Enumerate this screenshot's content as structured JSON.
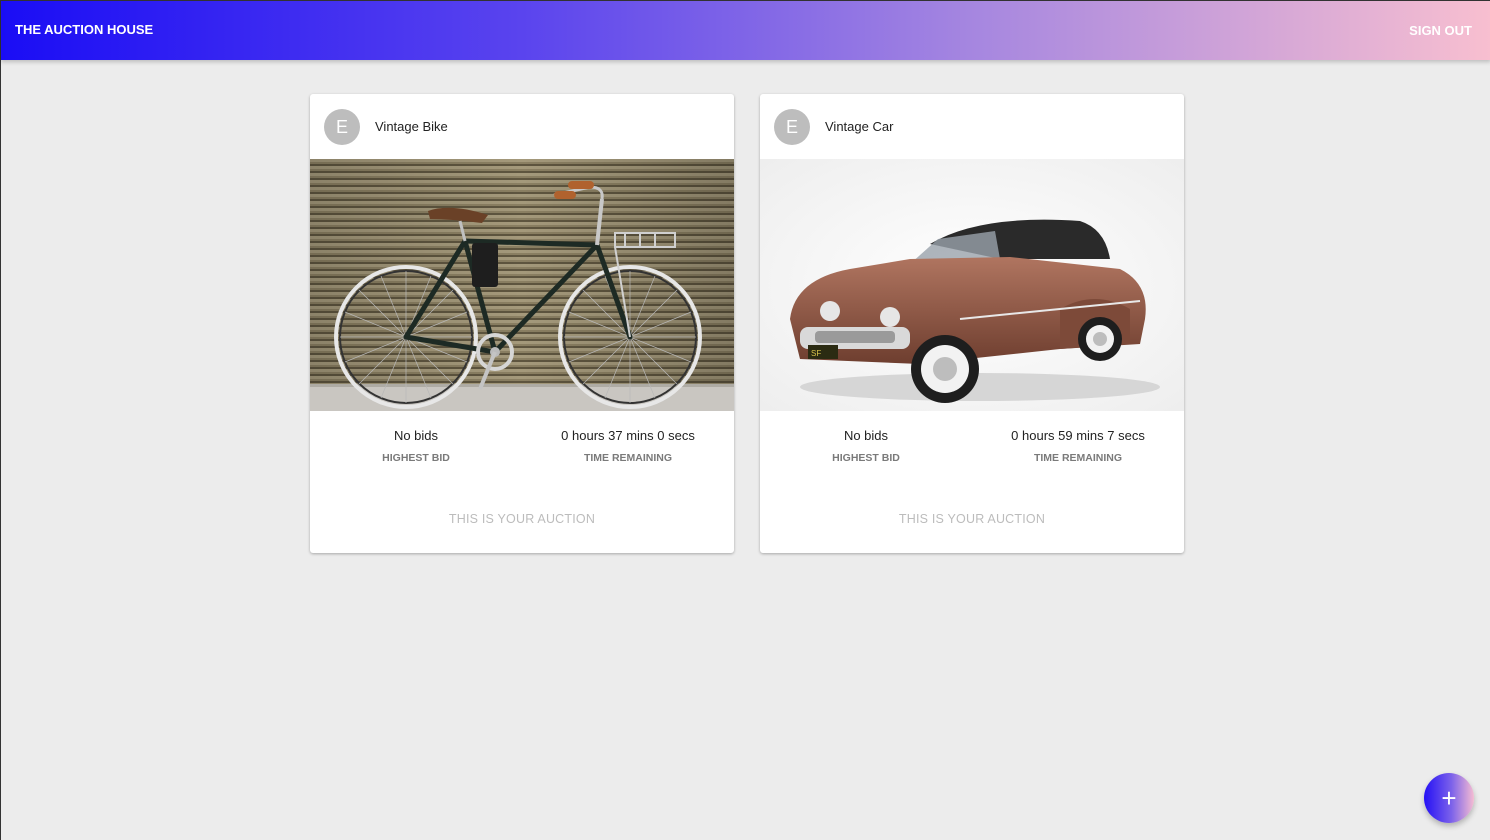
{
  "app": {
    "title": "THE AUCTION HOUSE",
    "sign_out_label": "SIGN OUT"
  },
  "colors": {
    "appbar_gradient_start": "#1a0df5",
    "appbar_gradient_end": "#f8bfd0",
    "background": "#ececec",
    "card": "#ffffff",
    "avatar": "#bdbdbd"
  },
  "auctions": [
    {
      "avatar_initial": "E",
      "title": "Vintage Bike",
      "image": "vintage-bicycle-photo",
      "highest_bid_value": "No bids",
      "highest_bid_label": "HIGHEST BID",
      "time_remaining_value": "0 hours 37 mins 0 secs",
      "time_remaining_label": "TIME REMAINING",
      "action_label": "THIS IS YOUR AUCTION"
    },
    {
      "avatar_initial": "E",
      "title": "Vintage Car",
      "image": "vintage-car-photo",
      "highest_bid_value": "No bids",
      "highest_bid_label": "HIGHEST BID",
      "time_remaining_value": "0 hours 59 mins 7 secs",
      "time_remaining_label": "TIME REMAINING",
      "action_label": "THIS IS YOUR AUCTION"
    }
  ],
  "fab": {
    "icon": "plus-icon",
    "glyph": "+"
  }
}
